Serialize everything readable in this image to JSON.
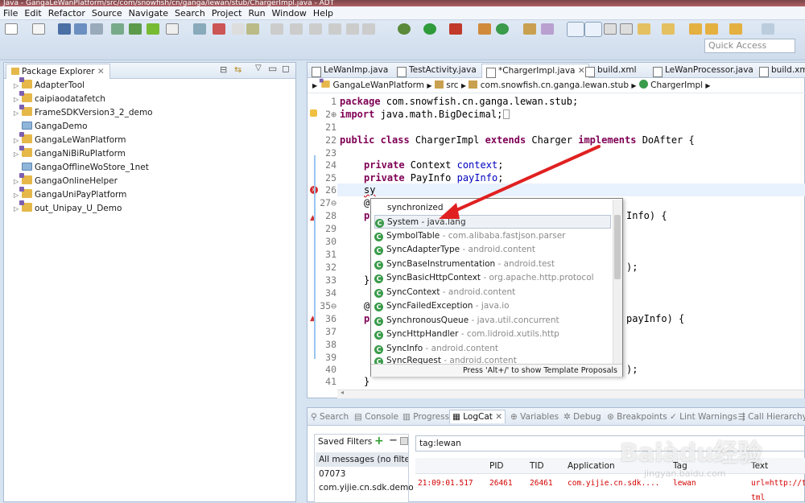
{
  "window": {
    "title": "Java - GangaLeWanPlatform/src/com/snowfish/cn/ganga/lewan/stub/ChargerImpl.java - ADT"
  },
  "menu": [
    "File",
    "Edit",
    "Refactor",
    "Source",
    "Navigate",
    "Search",
    "Project",
    "Run",
    "Window",
    "Help"
  ],
  "quick_access": "Quick Access",
  "package_explorer": {
    "tab_label": "Package Explorer",
    "items": [
      {
        "label": "AdapterTool",
        "expandable": true,
        "icon": "android-project-icon"
      },
      {
        "label": "caipiaodatafetch",
        "expandable": true,
        "icon": "android-project-icon"
      },
      {
        "label": "FrameSDKVersion3_2_demo",
        "expandable": true,
        "icon": "android-project-icon"
      },
      {
        "label": "GangaDemo",
        "expandable": false,
        "icon": "closed-project-icon"
      },
      {
        "label": "GangaLeWanPlatform",
        "expandable": true,
        "icon": "android-project-icon"
      },
      {
        "label": "GangaNiBiRuPlatform",
        "expandable": true,
        "icon": "android-project-icon"
      },
      {
        "label": "GangaOfflineWoStore_1net",
        "expandable": false,
        "icon": "closed-project-icon"
      },
      {
        "label": "GangaOnlineHelper",
        "expandable": true,
        "icon": "android-project-icon"
      },
      {
        "label": "GangaUniPayPlatform",
        "expandable": true,
        "icon": "android-project-icon"
      },
      {
        "label": "out_Unipay_U_Demo",
        "expandable": true,
        "icon": "android-project-icon"
      }
    ]
  },
  "editor": {
    "tabs": [
      "LeWanImp.java",
      "TestActivity.java",
      "*ChargerImpl.java",
      "build.xml",
      "LeWanProcessor.java",
      "build.xml"
    ],
    "breadcrumb": [
      "GangaLeWanPlatform",
      "src",
      "com.snowfish.cn.ganga.lewan.stub",
      "ChargerImpl"
    ],
    "line_numbers": [
      "1",
      "2⊕",
      "21",
      "22",
      "23",
      "24",
      "25",
      "26",
      "27⊖",
      "28",
      "29",
      "30",
      "31",
      "32",
      "33",
      "34",
      "35⊖",
      "36",
      "37",
      "38",
      "39",
      "40",
      "41"
    ],
    "lines": {
      "l1_kw": "package",
      "l1": " com.snowfish.cn.ganga.lewan.stub;",
      "l2_kw": "import",
      "l2": " java.math.BigDecimal;",
      "l22_kw1": "public class",
      "l22_a": " ChargerImpl ",
      "l22_kw2": "extends",
      "l22_b": " Charger ",
      "l22_kw3": "implements",
      "l22_c": " DoAfter {",
      "l24_kw": "private",
      "l24_a": " Context ",
      "l24_f": "context",
      "l25_kw": "private",
      "l25_a": " PayInfo ",
      "l25_f": "payInfo",
      "l26": "sy",
      "l27": "@",
      "l28_p": "p",
      "l28_tail": "Info) {",
      "l32_tail": ");",
      "l33": "}",
      "l35": "@",
      "l36_p": "p",
      "l36_tail": "payInfo) {",
      "l40_tail": ");",
      "l41": "}"
    }
  },
  "autocomplete": {
    "items": [
      {
        "name": "synchronized",
        "pkg": "",
        "icon": "none"
      },
      {
        "name": "System",
        "pkg": " - java.lang",
        "icon": "class-icon"
      },
      {
        "name": "SymbolTable",
        "pkg": " - com.alibaba.fastjson.parser",
        "icon": "class-icon"
      },
      {
        "name": "SyncAdapterType",
        "pkg": " - android.content",
        "icon": "class-icon"
      },
      {
        "name": "SyncBaseInstrumentation",
        "pkg": " - android.test",
        "icon": "class-icon"
      },
      {
        "name": "SyncBasicHttpContext",
        "pkg": " - org.apache.http.protocol",
        "icon": "class-icon"
      },
      {
        "name": "SyncContext",
        "pkg": " - android.content",
        "icon": "class-icon"
      },
      {
        "name": "SyncFailedException",
        "pkg": " - java.io",
        "icon": "class-icon"
      },
      {
        "name": "SynchronousQueue",
        "pkg": " - java.util.concurrent",
        "icon": "class-icon"
      },
      {
        "name": "SyncHttpHandler",
        "pkg": " - com.lidroid.xutils.http",
        "icon": "class-icon"
      },
      {
        "name": "SyncInfo",
        "pkg": " - android.content",
        "icon": "class-icon"
      },
      {
        "name": "SyncRequest",
        "pkg": " - android.content",
        "icon": "class-icon"
      }
    ],
    "status": "Press 'Alt+/' to show Template Proposals"
  },
  "bottom": {
    "tabs": [
      "Search",
      "Console",
      "Progress",
      "LogCat",
      "Variables",
      "Debug",
      "Breakpoints",
      "Lint Warnings",
      "Call Hierarchy"
    ],
    "saved_filters": "Saved Filters",
    "filters": [
      "All messages (no filter",
      "07073",
      "com.yijie.cn.sdk.demo"
    ],
    "search": "tag:lewan",
    "columns": [
      "PID",
      "TID",
      "Application",
      "Tag",
      "Text"
    ],
    "row": {
      "time": "21:09:01.517",
      "pid": "26461",
      "tid": "26461",
      "app": "com.yijie.cn.sdk....",
      "tag": "lewan",
      "text": "url=http://t",
      "text2": "tml"
    }
  },
  "watermark": "Baiàdu经验",
  "watermark_url": "jingyan.baidu.com"
}
